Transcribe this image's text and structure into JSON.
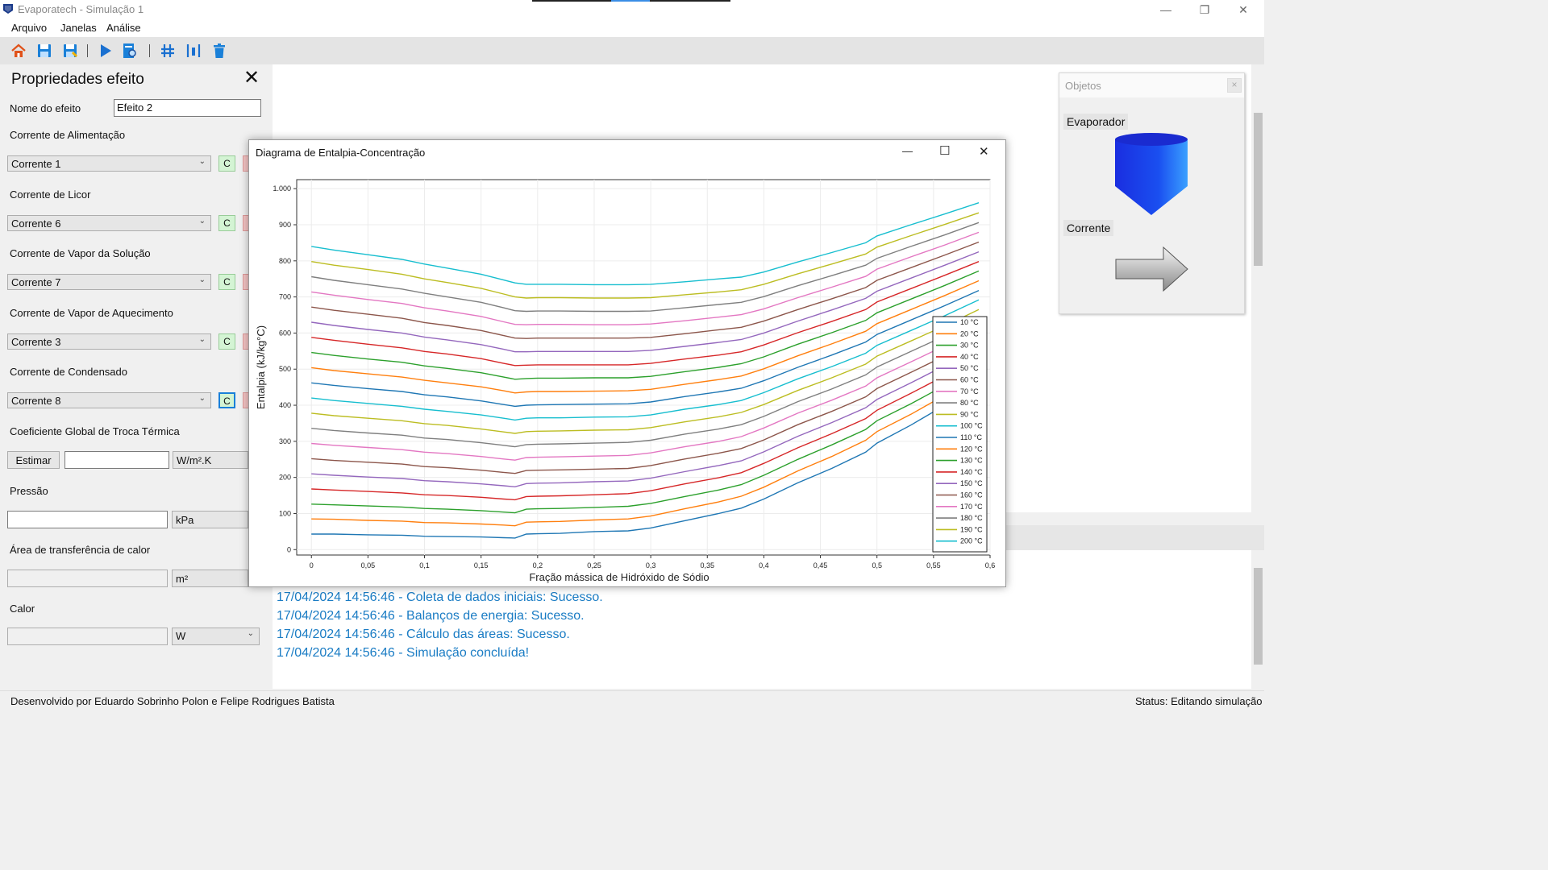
{
  "window": {
    "title": "Evaporatech - Simulação 1",
    "min_glyph": "—",
    "max_glyph": "❐",
    "close_glyph": "✕"
  },
  "menu": {
    "items": [
      "Arquivo",
      "Janelas",
      "Análise"
    ]
  },
  "toolbar": {
    "icons": [
      "home-icon",
      "save-icon",
      "save-as-icon",
      "play-icon",
      "simulate-report-icon",
      "grid-icon",
      "align-icon",
      "trash-icon"
    ]
  },
  "props": {
    "title": "Propriedades efeito",
    "close_glyph": "✕",
    "nome_label": "Nome do efeito",
    "nome_value": "Efeito 2",
    "alimentacao_label": "Corrente de Alimentação",
    "alimentacao_value": "Corrente 1",
    "licor_label": "Corrente de Licor",
    "licor_value": "Corrente 6",
    "vapor_solucao_label": "Corrente de Vapor da Solução",
    "vapor_solucao_value": "Corrente 7",
    "vapor_aquecimento_label": "Corrente de Vapor de Aquecimento",
    "vapor_aquecimento_value": "Corrente 3",
    "condensado_label": "Corrente de Condensado",
    "condensado_value": "Corrente 8",
    "c_button": "C",
    "coef_label": "Coeficiente Global de Troca Térmica",
    "estimar_button": "Estimar",
    "coef_value": "",
    "coef_unit": "W/m².K",
    "pressao_label": "Pressão",
    "pressao_value": "",
    "pressao_unit": "kPa",
    "area_label": "Área de transferência de calor",
    "area_value": "",
    "area_unit": "m²",
    "calor_label": "Calor",
    "calor_value": "",
    "calor_unit": "W",
    "dropdown_glyph": "⌄"
  },
  "objects": {
    "title": "Objetos",
    "close_glyph": "×",
    "evaporador_label": "Evaporador",
    "corrente_label": "Corrente"
  },
  "log": {
    "lines": [
      "17/04/2024 14:56:46 - Coleta de dados iniciais: Sucesso.",
      "17/04/2024 14:56:46 - Balanços de energia: Sucesso.",
      "17/04/2024 14:56:46 - Cálculo das áreas: Sucesso.",
      "17/04/2024 14:56:46 - Simulação concluída!"
    ]
  },
  "status": {
    "left": "Desenvolvido por Eduardo Sobrinho Polon e Felipe Rodrigues Batista",
    "right": "Status: Editando simulação"
  },
  "dialog": {
    "title": "Diagrama de Entalpia-Concentração",
    "min_glyph": "—",
    "max_glyph": "☐",
    "close_glyph": "✕"
  },
  "chart_data": {
    "type": "line",
    "title": "",
    "xlabel": "Fração mássica de Hidróxido de Sódio",
    "ylabel": "Entalpia (kJ/kg°C)",
    "xlim": [
      -0.013,
      0.6
    ],
    "ylim": [
      -15,
      1025
    ],
    "x_ticks": [
      0,
      0.05,
      0.1,
      0.15,
      0.2,
      0.25,
      0.3,
      0.35,
      0.4,
      0.45,
      0.5,
      0.55,
      0.6
    ],
    "x_tick_labels": [
      "0",
      "0,05",
      "0,1",
      "0,15",
      "0,2",
      "0,25",
      "0,3",
      "0,35",
      "0,4",
      "0,45",
      "0,5",
      "0,55",
      "0,6"
    ],
    "y_ticks": [
      0,
      100,
      200,
      300,
      400,
      500,
      600,
      700,
      800,
      900,
      1000
    ],
    "y_tick_labels": [
      "0",
      "100",
      "200",
      "300",
      "400",
      "500",
      "600",
      "700",
      "800",
      "900",
      "1.000"
    ],
    "grid": true,
    "legend": "bottom-right",
    "x": [
      0,
      0.02,
      0.05,
      0.08,
      0.1,
      0.12,
      0.15,
      0.17,
      0.18,
      0.19,
      0.2,
      0.22,
      0.25,
      0.28,
      0.3,
      0.33,
      0.36,
      0.38,
      0.4,
      0.43,
      0.46,
      0.49,
      0.5,
      0.53,
      0.56,
      0.59
    ],
    "series": [
      {
        "name": "10 °C",
        "color": "#1f77b4",
        "values": [
          43,
          43,
          41,
          40,
          37,
          36,
          35,
          33,
          32,
          43,
          44,
          45,
          50,
          52,
          60,
          80,
          100,
          115,
          140,
          185,
          225,
          270,
          295,
          345,
          400,
          450
        ]
      },
      {
        "name": "20 °C",
        "color": "#ff7f0e",
        "values": [
          85,
          84,
          81,
          79,
          75,
          74,
          71,
          68,
          66,
          76,
          77,
          78,
          82,
          85,
          93,
          113,
          132,
          148,
          173,
          218,
          258,
          303,
          327,
          375,
          428,
          478
        ]
      },
      {
        "name": "30 °C",
        "color": "#2ca02c",
        "values": [
          126,
          124,
          121,
          118,
          114,
          112,
          108,
          104,
          102,
          112,
          113,
          114,
          117,
          120,
          128,
          147,
          165,
          180,
          206,
          250,
          290,
          333,
          357,
          404,
          455,
          505
        ]
      },
      {
        "name": "40 °C",
        "color": "#d62728",
        "values": [
          168,
          165,
          161,
          157,
          152,
          150,
          145,
          140,
          138,
          147,
          148,
          149,
          152,
          155,
          163,
          182,
          199,
          213,
          239,
          282,
          321,
          363,
          386,
          433,
          482,
          532
        ]
      },
      {
        "name": "50 °C",
        "color": "#9467bd",
        "values": [
          210,
          206,
          201,
          197,
          191,
          188,
          182,
          177,
          174,
          183,
          184,
          185,
          188,
          190,
          198,
          216,
          233,
          246,
          271,
          314,
          352,
          393,
          416,
          462,
          510,
          558
        ]
      },
      {
        "name": "60 °C",
        "color": "#8c564b",
        "values": [
          252,
          247,
          242,
          237,
          230,
          227,
          220,
          214,
          211,
          219,
          220,
          221,
          223,
          225,
          233,
          251,
          267,
          280,
          304,
          346,
          383,
          423,
          446,
          491,
          537,
          585
        ]
      },
      {
        "name": "70 °C",
        "color": "#e377c2",
        "values": [
          294,
          289,
          283,
          277,
          270,
          266,
          258,
          251,
          248,
          255,
          256,
          257,
          259,
          261,
          268,
          285,
          300,
          313,
          337,
          378,
          414,
          453,
          476,
          520,
          565,
          612
        ]
      },
      {
        "name": "80 °C",
        "color": "#7f7f7f",
        "values": [
          336,
          330,
          323,
          317,
          309,
          305,
          296,
          289,
          285,
          291,
          292,
          293,
          295,
          297,
          303,
          320,
          334,
          346,
          369,
          410,
          445,
          484,
          506,
          549,
          592,
          638
        ]
      },
      {
        "name": "90 °C",
        "color": "#bcbd22",
        "values": [
          378,
          371,
          364,
          357,
          349,
          344,
          334,
          326,
          322,
          327,
          328,
          329,
          331,
          332,
          338,
          354,
          368,
          380,
          402,
          441,
          476,
          514,
          536,
          578,
          620,
          665
        ]
      },
      {
        "name": "100 °C",
        "color": "#17becf",
        "values": [
          420,
          413,
          405,
          397,
          389,
          383,
          373,
          364,
          359,
          364,
          365,
          365,
          367,
          368,
          373,
          389,
          402,
          413,
          435,
          473,
          507,
          544,
          566,
          607,
          648,
          692
        ]
      },
      {
        "name": "110 °C",
        "color": "#1f77b4",
        "values": [
          462,
          455,
          446,
          438,
          429,
          423,
          412,
          402,
          397,
          400,
          401,
          402,
          403,
          404,
          409,
          424,
          437,
          447,
          468,
          505,
          539,
          575,
          596,
          636,
          676,
          718
        ]
      },
      {
        "name": "120 °C",
        "color": "#ff7f0e",
        "values": [
          504,
          496,
          487,
          478,
          469,
          462,
          451,
          440,
          434,
          437,
          438,
          438,
          439,
          440,
          444,
          458,
          471,
          481,
          501,
          537,
          570,
          605,
          626,
          665,
          704,
          745
        ]
      },
      {
        "name": "130 °C",
        "color": "#2ca02c",
        "values": [
          546,
          538,
          528,
          519,
          509,
          502,
          490,
          478,
          472,
          474,
          475,
          475,
          476,
          476,
          480,
          493,
          505,
          515,
          534,
          569,
          601,
          635,
          656,
          694,
          732,
          772
        ]
      },
      {
        "name": "140 °C",
        "color": "#d62728",
        "values": [
          588,
          580,
          569,
          559,
          549,
          542,
          529,
          516,
          510,
          511,
          512,
          512,
          512,
          512,
          516,
          528,
          539,
          548,
          567,
          601,
          632,
          665,
          686,
          723,
          760,
          798
        ]
      },
      {
        "name": "150 °C",
        "color": "#9467bd",
        "values": [
          630,
          621,
          610,
          600,
          589,
          581,
          568,
          555,
          548,
          548,
          549,
          549,
          549,
          549,
          552,
          563,
          574,
          582,
          600,
          633,
          664,
          696,
          716,
          752,
          788,
          825
        ]
      },
      {
        "name": "160 °C",
        "color": "#8c564b",
        "values": [
          672,
          663,
          652,
          641,
          629,
          621,
          607,
          593,
          586,
          585,
          586,
          586,
          586,
          586,
          588,
          598,
          609,
          616,
          633,
          665,
          695,
          726,
          746,
          781,
          816,
          852
        ]
      },
      {
        "name": "170 °C",
        "color": "#e377c2",
        "values": [
          714,
          705,
          693,
          682,
          670,
          661,
          646,
          631,
          624,
          623,
          624,
          624,
          623,
          623,
          625,
          634,
          644,
          651,
          667,
          698,
          727,
          757,
          777,
          811,
          844,
          879
        ]
      },
      {
        "name": "180 °C",
        "color": "#7f7f7f",
        "values": [
          756,
          746,
          734,
          722,
          710,
          700,
          685,
          670,
          662,
          660,
          661,
          661,
          660,
          660,
          661,
          670,
          679,
          685,
          701,
          731,
          759,
          788,
          807,
          840,
          872,
          906
        ]
      },
      {
        "name": "190 °C",
        "color": "#bcbd22",
        "values": [
          798,
          788,
          776,
          763,
          750,
          740,
          724,
          708,
          700,
          697,
          698,
          698,
          697,
          697,
          698,
          706,
          714,
          720,
          735,
          764,
          791,
          819,
          838,
          870,
          901,
          933
        ]
      },
      {
        "name": "200 °C",
        "color": "#17becf",
        "values": [
          840,
          830,
          817,
          804,
          791,
          780,
          763,
          747,
          739,
          735,
          735,
          735,
          734,
          734,
          735,
          742,
          750,
          755,
          769,
          797,
          823,
          850,
          869,
          900,
          930,
          961
        ]
      }
    ]
  }
}
